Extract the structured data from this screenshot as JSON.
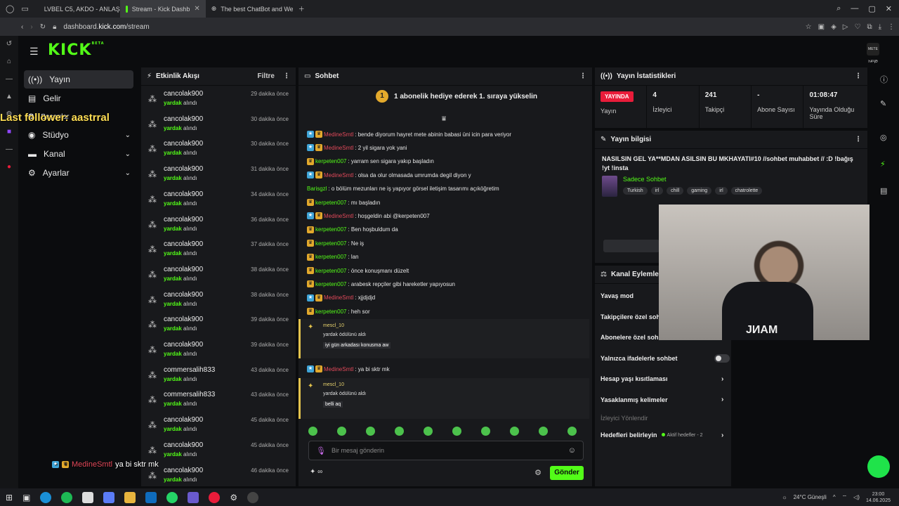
{
  "browser": {
    "tabs": [
      {
        "label": "LVBEL C5, AKDO - ANLAŞ",
        "color": "#e91c3a"
      },
      {
        "label": "Stream - Kick Dashb",
        "color": "#53fc18"
      },
      {
        "label": "The best ChatBot and We",
        "color": "#ffffff"
      }
    ],
    "url_prefix": "dashboard.",
    "url_host": "kick.com",
    "url_path": "/stream"
  },
  "kick": {
    "logo": "KICK",
    "logo_tag": "BETA",
    "avatar_text": "MEТЕ ҺҰҶӘ"
  },
  "nav": {
    "items": [
      {
        "label": "Yayın",
        "icon": "broadcast-icon"
      },
      {
        "label": "Gelir",
        "icon": "revenue-icon"
      },
      {
        "label": "Başarılar",
        "icon": "achievement-icon"
      },
      {
        "label": "Stüdyo",
        "icon": "studio-icon"
      },
      {
        "label": "Kanal",
        "icon": "channel-icon"
      },
      {
        "label": "Ayarlar",
        "icon": "settings-icon"
      }
    ]
  },
  "overlay": {
    "follower": "Last follower: aastrral",
    "chat_user": "MedineSmtl",
    "chat_msg": "ya bi sktr mk"
  },
  "activity": {
    "title": "Etkinlik Akışı",
    "filter": "Filtre",
    "reward": "yardak",
    "reward_suffix": "alındı",
    "items": [
      {
        "user": "cancolak900",
        "time": "29 dakika önce"
      },
      {
        "user": "cancolak900",
        "time": "30 dakika önce"
      },
      {
        "user": "cancolak900",
        "time": "30 dakika önce"
      },
      {
        "user": "cancolak900",
        "time": "31 dakika önce"
      },
      {
        "user": "cancolak900",
        "time": "34 dakika önce"
      },
      {
        "user": "cancolak900",
        "time": "36 dakika önce"
      },
      {
        "user": "cancolak900",
        "time": "37 dakika önce"
      },
      {
        "user": "cancolak900",
        "time": "38 dakika önce"
      },
      {
        "user": "cancolak900",
        "time": "38 dakika önce"
      },
      {
        "user": "cancolak900",
        "time": "39 dakika önce"
      },
      {
        "user": "cancolak900",
        "time": "39 dakika önce"
      },
      {
        "user": "commersalih833",
        "time": "43 dakika önce"
      },
      {
        "user": "commersalih833",
        "time": "43 dakika önce"
      },
      {
        "user": "cancolak900",
        "time": "45 dakika önce"
      },
      {
        "user": "cancolak900",
        "time": "45 dakika önce"
      },
      {
        "user": "cancolak900",
        "time": "46 dakika önce"
      }
    ]
  },
  "chat": {
    "title": "Sohbet",
    "banner_num": "1",
    "banner": "1 abonelik hediye ederek 1. sıraya yükselin",
    "messages": [
      {
        "user": "MedineSmtl",
        "color": "r",
        "badges": 2,
        "text": ": bende diyorum hayret mete abinin babasi üni icin para veriyor"
      },
      {
        "user": "MedineSmtl",
        "color": "r",
        "badges": 2,
        "text": ": 2 yil sigara yok yani"
      },
      {
        "user": "kerpeten007",
        "color": "g",
        "badges": 1,
        "text": ": yarram sen sigara yakıp başladın"
      },
      {
        "user": "MedineSmtl",
        "color": "r",
        "badges": 2,
        "text": ": olsa da olur olmasada umrumda degil diyon y"
      },
      {
        "user": "Barisgzl",
        "color": "g",
        "badges": 0,
        "text": ": o bölüm mezunları ne iş yapıyor görsel iletişim tasarımı açıköğretim"
      },
      {
        "user": "kerpeten007",
        "color": "g",
        "badges": 1,
        "text": ": mı başladın"
      },
      {
        "user": "MedineSmtl",
        "color": "r",
        "badges": 2,
        "text": ": hoşgeldin abi @kerpeten007"
      },
      {
        "user": "kerpeten007",
        "color": "g",
        "badges": 1,
        "text": ": Ben hoşbuldum da"
      },
      {
        "user": "kerpeten007",
        "color": "g",
        "badges": 1,
        "text": ": Ne iş"
      },
      {
        "user": "kerpeten007",
        "color": "g",
        "badges": 1,
        "text": ": lan"
      },
      {
        "user": "kerpeten007",
        "color": "g",
        "badges": 1,
        "text": ": önce konuşmanı düzelt"
      },
      {
        "user": "kerpeten007",
        "color": "g",
        "badges": 1,
        "text": ": arabesk repçiler gibi hareketler yapıyosun"
      },
      {
        "user": "MedineSmtl",
        "color": "r",
        "badges": 2,
        "text": ": xjjdjdjd"
      },
      {
        "user": "kerpeten007",
        "color": "g",
        "badges": 1,
        "text": ": heh sor"
      }
    ],
    "redeem1": {
      "user": "mescl_10",
      "text": "yardak ödülünü aldı",
      "msg": "iyi gün arkadası konusma aw"
    },
    "after": {
      "user": "MedineSmtl",
      "text": ": ya bi sktr mk"
    },
    "redeem2": {
      "user": "mescl_10",
      "text": "yardak ödülünü aldı",
      "msg": "belli aq"
    },
    "input_placeholder": "Bir mesaj gönderin",
    "points": "∞",
    "send": "Gönder"
  },
  "stats": {
    "title": "Yayın İstatistikleri",
    "live": "YAYINDA",
    "cells": [
      {
        "value": "",
        "label": "Yayın"
      },
      {
        "value": "4",
        "label": "İzleyici"
      },
      {
        "value": "241",
        "label": "Takipçi"
      },
      {
        "value": "-",
        "label": "Abone Sayısı"
      },
      {
        "value": "01:08:47",
        "label": "Yayında Olduğu Süre"
      }
    ]
  },
  "info": {
    "title": "Yayın bilgisi",
    "stream_title": "NASILSIN GEL YA**MDAN ASILSIN BU MKHAYATI#10 //sohbet muhabbet // :D !bağış !yt !insta",
    "category": "Sadece Sohbet",
    "tags": [
      "Turkish",
      "irl",
      "chill",
      "gaming",
      "irl",
      "chatrolette"
    ]
  },
  "actions": {
    "title": "Kanal Eylemleri",
    "rows": [
      {
        "label": "Yavaş mod",
        "kind": "none"
      },
      {
        "label": "Takipçilere özel sohbet",
        "kind": "none"
      },
      {
        "label": "Abonelere özel sohbet",
        "kind": "none"
      },
      {
        "label": "Yalnızca ifadelerle sohbet",
        "kind": "toggle"
      },
      {
        "label": "Hesap yaşı kısıtlaması",
        "kind": "chev"
      },
      {
        "label": "Yasaklanmış kelimeler",
        "kind": "chev"
      }
    ],
    "section": "İzleyici Yönlendir",
    "goals": "Hedefleri belirleyin",
    "goals_active": "Aktif hedefler - 2"
  },
  "webcam": {
    "shirt": "ЈИАМ"
  },
  "taskbar": {
    "weather": "24°C Güneşli",
    "time": "23:00",
    "date": "14.06.2025"
  }
}
